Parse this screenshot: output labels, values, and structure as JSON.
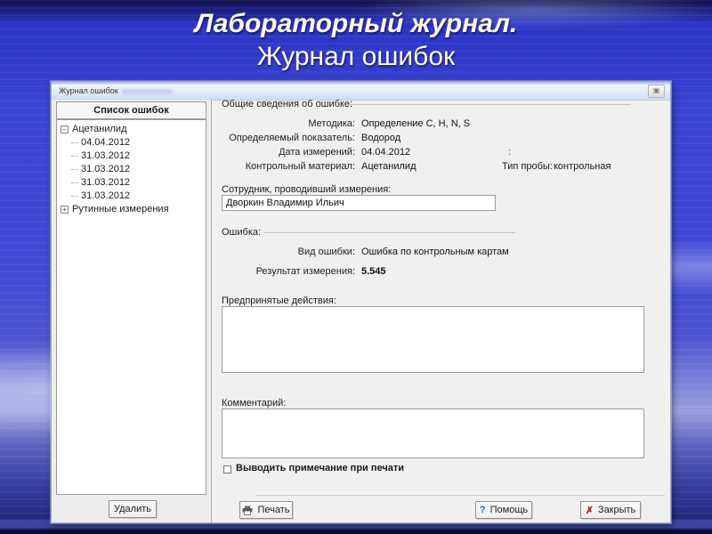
{
  "slide": {
    "title_line1": "Лабораторный журнал.",
    "title_line2": "Журнал ошибок"
  },
  "window": {
    "title": "Журнал ошибок",
    "close_glyph": "▣",
    "left_panel": {
      "header": "Список ошибок",
      "tree": [
        {
          "label": "Ацетанилид",
          "expander": "−"
        },
        {
          "label": "04.04.2012"
        },
        {
          "label": "31.03.2012"
        },
        {
          "label": "31.03.2012"
        },
        {
          "label": "31.03.2012"
        },
        {
          "label": "31.03.2012"
        },
        {
          "label": "Рутинные измерения",
          "expander": "+"
        }
      ],
      "delete_button": "Удалить"
    },
    "general_section": {
      "title": "Общие сведения об ошибке:",
      "rows": [
        {
          "label": "Методика:",
          "value": "Определение C, H, N, S"
        },
        {
          "label": "Определяемый показатель:",
          "value": "Водород"
        },
        {
          "label": "Дата измерений:",
          "value": "04.04.2012"
        },
        {
          "label": "Контрольный материал:",
          "value": "Ацетанилид"
        }
      ],
      "stray_colon": ":",
      "sample_type_label": "Тип пробы:",
      "sample_type_value": "контрольная",
      "employee_label": "Сотрудник, проводивший измерения:",
      "employee_value": "Дворкин Владимир Ильич"
    },
    "error_section": {
      "title": "Ошибка:",
      "kind_label": "Вид ошибки:",
      "kind_value": "Ошибка по контрольным картам",
      "result_label": "Результат измерения:",
      "result_value": "5.545",
      "actions_label": "Предпринятые действия:",
      "actions_value": "",
      "comment_label": "Комментарий:",
      "comment_value": "",
      "checkbox_label": "Выводить примечание при печати",
      "checkbox_checked": false
    },
    "buttons": {
      "print": "Печать",
      "help": "Помощь",
      "help_icon": "?",
      "close": "Закрыть",
      "close_icon": "✗"
    }
  },
  "colors": {
    "help_icon": "#1464c8",
    "close_icon": "#c01818",
    "slide_title": "#fdf9e3",
    "window_bg": "#f0f0ee"
  }
}
